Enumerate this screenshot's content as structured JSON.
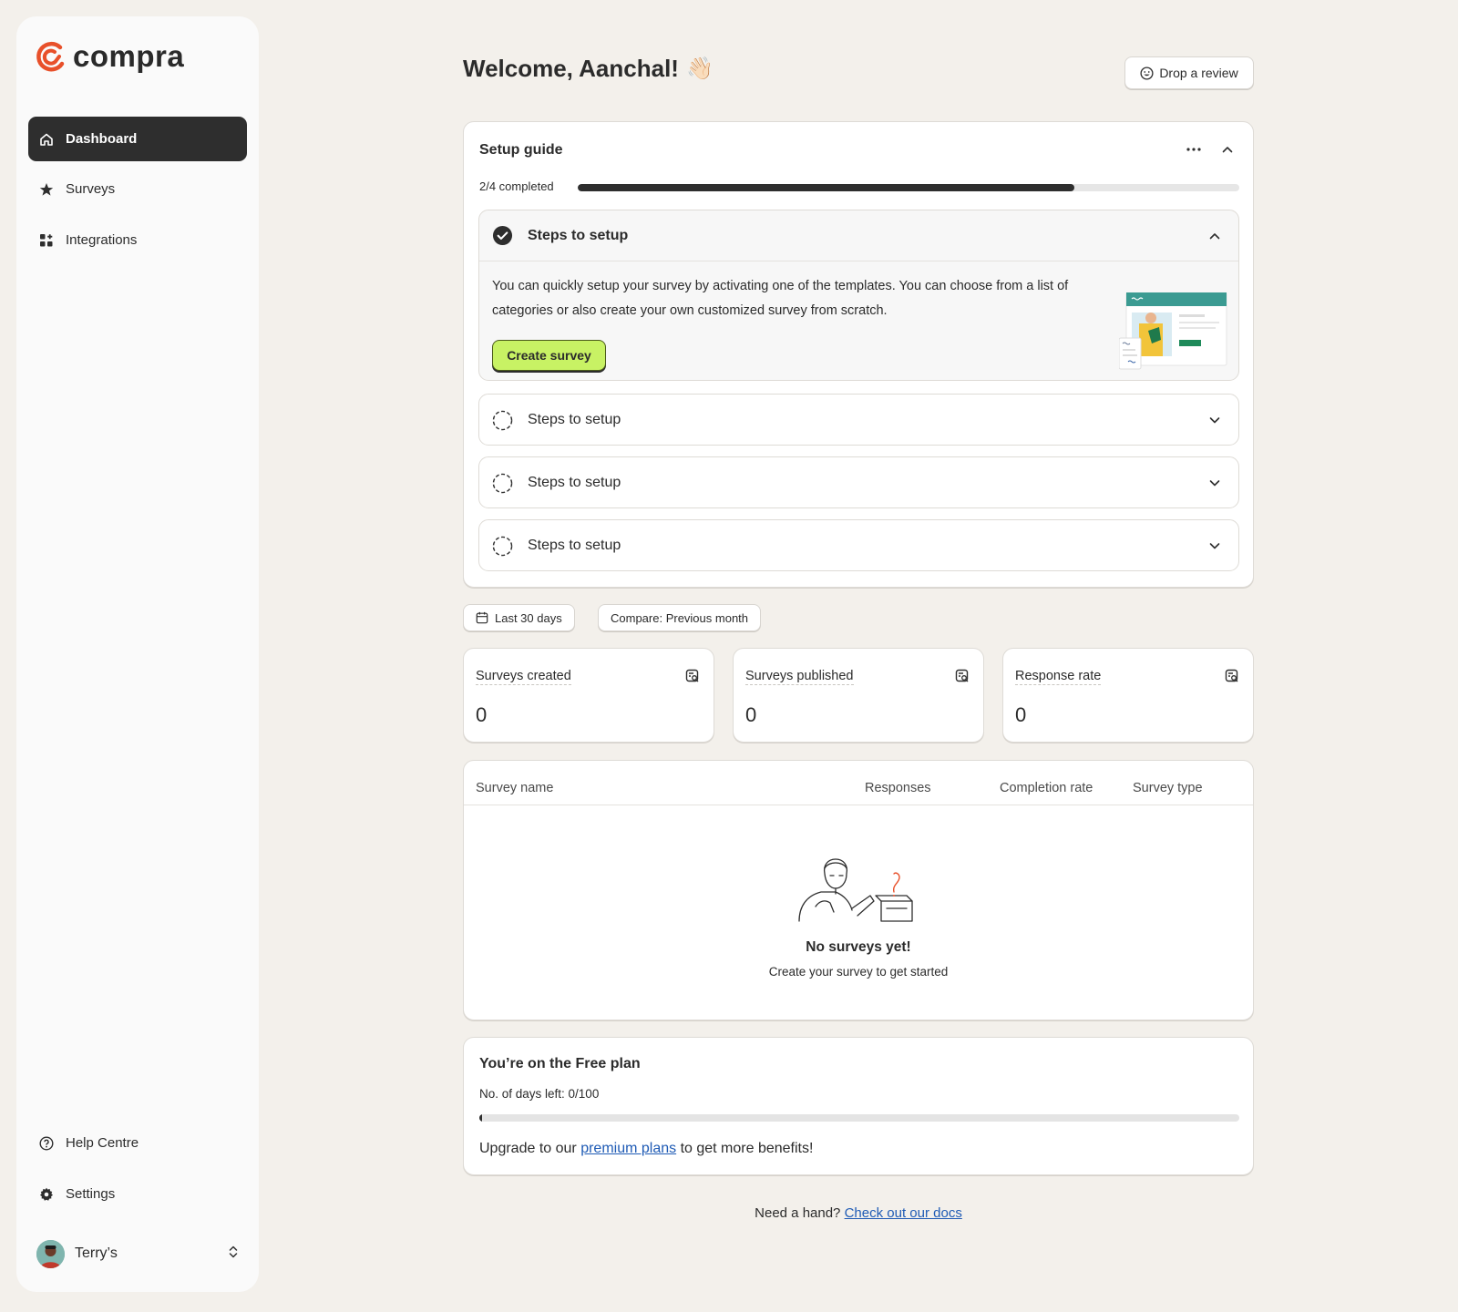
{
  "sidebar": {
    "brand": "compra",
    "nav": [
      {
        "label": "Dashboard",
        "icon": "home-icon",
        "active": true
      },
      {
        "label": "Surveys",
        "icon": "star-icon",
        "active": false
      },
      {
        "label": "Integrations",
        "icon": "grid-icon",
        "active": false
      }
    ],
    "bottom": [
      {
        "label": "Help Centre",
        "icon": "help-icon"
      },
      {
        "label": "Settings",
        "icon": "gear-icon"
      }
    ],
    "user": {
      "name": "Terry’s"
    }
  },
  "header": {
    "welcome": "Welcome, Aanchal!",
    "wave_emoji": "👋🏻",
    "review_button": "Drop a review"
  },
  "setup": {
    "title": "Setup guide",
    "progress_label": "2/4 completed",
    "progress_fraction": 0.75,
    "steps": [
      {
        "title": "Steps to setup",
        "completed": true,
        "expanded": true,
        "description": "You can quickly setup your survey by activating one of the templates. You can choose from a list of categories or also create your own customized survey from scratch.",
        "cta": "Create survey"
      },
      {
        "title": "Steps to setup",
        "completed": false,
        "expanded": false
      },
      {
        "title": "Steps to setup",
        "completed": false,
        "expanded": false
      },
      {
        "title": "Steps to setup",
        "completed": false,
        "expanded": false
      }
    ]
  },
  "filters": {
    "date_range": "Last 30 days",
    "compare": "Compare: Previous month"
  },
  "stats": [
    {
      "label": "Surveys created",
      "value": "0"
    },
    {
      "label": "Surveys published",
      "value": "0"
    },
    {
      "label": "Response rate",
      "value": "0"
    }
  ],
  "table": {
    "columns": [
      "Survey name",
      "Responses",
      "Completion rate",
      "Survey type"
    ],
    "empty_title": "No surveys yet!",
    "empty_subtitle": "Create your survey to get started"
  },
  "plan": {
    "title": "You’re on the Free plan",
    "days_left": "No. of days left: 0/100",
    "days_fraction": 0,
    "upgrade_prefix": "Upgrade to our",
    "upgrade_link": "premium plans",
    "upgrade_suffix": "to get more benefits!"
  },
  "footer": {
    "prefix": "Need a hand?",
    "link": "Check out our docs"
  },
  "colors": {
    "accent_lime": "#c8f264",
    "brand_orange": "#e8502a",
    "dark": "#2e2e2e",
    "link": "#1f5bb5"
  }
}
